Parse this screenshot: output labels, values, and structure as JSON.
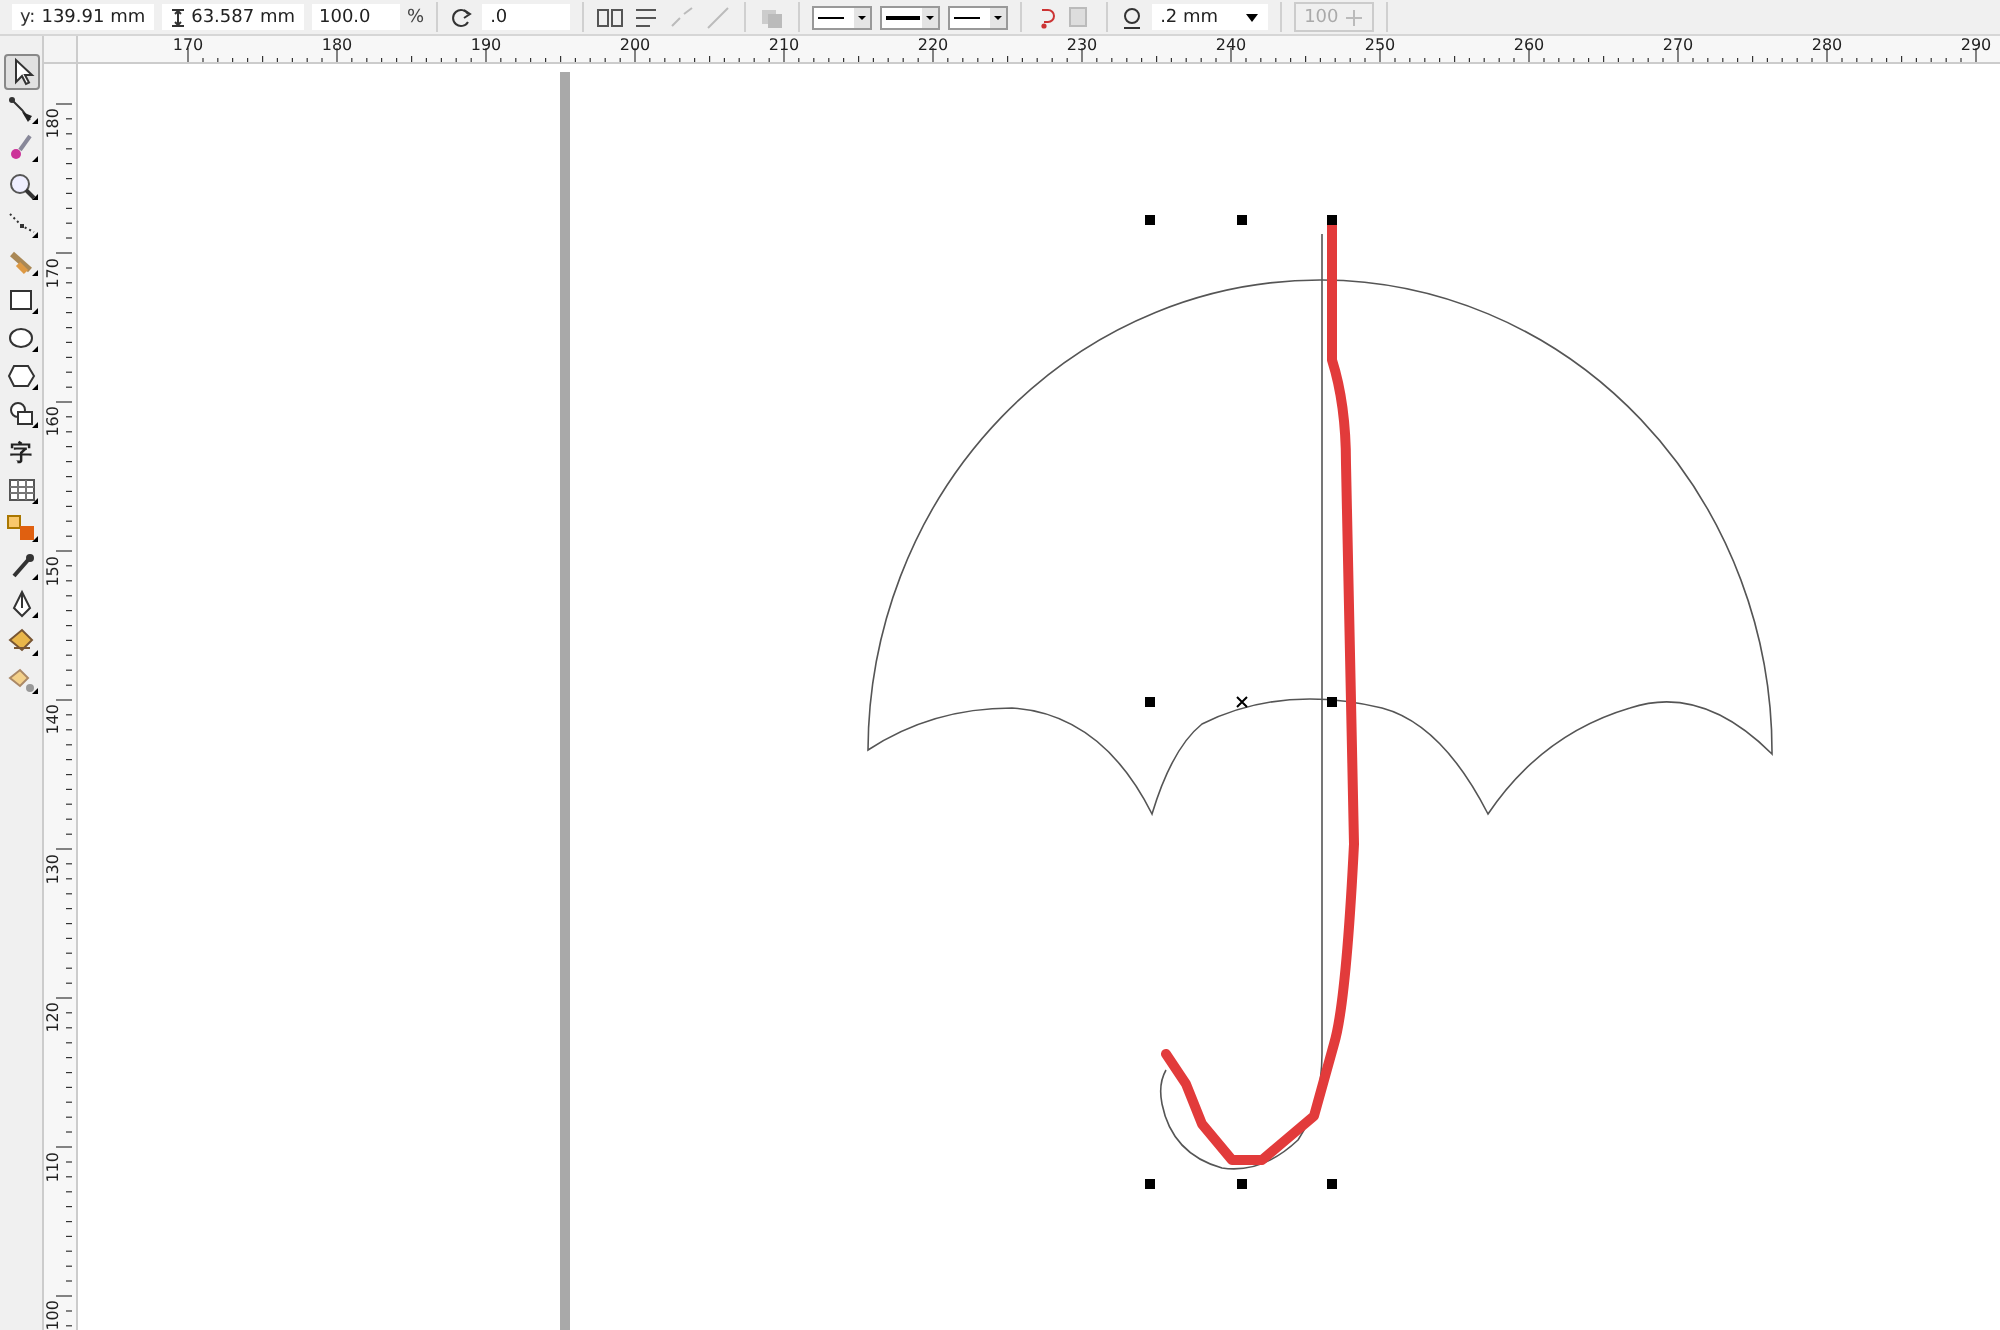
{
  "property_bar": {
    "y_label": "y:",
    "y_value": "139.91 mm",
    "height_value": "63.587 mm",
    "scale_value": "100.0",
    "scale_unit": "%",
    "rotation_value": ".0",
    "outline_width": ".2 mm",
    "opacity_value": "100"
  },
  "rulers": {
    "horizontal": [
      "170",
      "180",
      "190",
      "200",
      "210",
      "220",
      "230",
      "240",
      "250",
      "260",
      "270",
      "280",
      "290"
    ],
    "vertical": [
      "180",
      "170",
      "160",
      "150",
      "140",
      "130",
      "120",
      "110",
      "100"
    ]
  },
  "toolbox": [
    {
      "kind": "pick",
      "selected": true
    },
    {
      "kind": "shape",
      "selected": false
    },
    {
      "kind": "smear",
      "selected": false
    },
    {
      "kind": "zoom",
      "selected": false
    },
    {
      "kind": "curve",
      "selected": false
    },
    {
      "kind": "artistic",
      "selected": false
    },
    {
      "kind": "rectangle",
      "selected": false
    },
    {
      "kind": "ellipse",
      "selected": false
    },
    {
      "kind": "polygon",
      "selected": false
    },
    {
      "kind": "shapes",
      "selected": false
    },
    {
      "kind": "text",
      "label": "字",
      "selected": false
    },
    {
      "kind": "table",
      "selected": false
    },
    {
      "kind": "blend",
      "selected": false
    },
    {
      "kind": "eyedropper",
      "selected": false
    },
    {
      "kind": "outline",
      "selected": false
    },
    {
      "kind": "fill",
      "selected": false
    },
    {
      "kind": "smartfill",
      "selected": false
    }
  ]
}
